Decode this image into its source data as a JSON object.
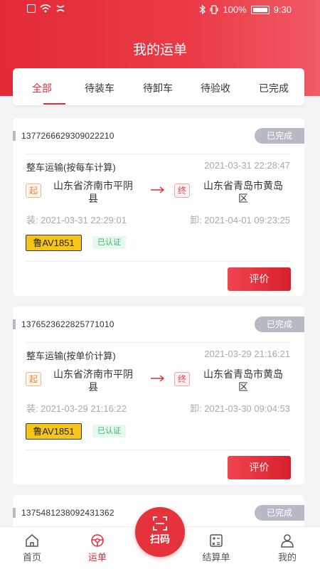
{
  "status_bar": {
    "battery": "100%",
    "time": "9:30"
  },
  "title": "我的运单",
  "tabs": [
    {
      "label": "全部",
      "active": true
    },
    {
      "label": "待装车"
    },
    {
      "label": "待卸车"
    },
    {
      "label": "待验收"
    },
    {
      "label": "已完成"
    }
  ],
  "orders": [
    {
      "id": "1377266629309022210",
      "status": "已完成",
      "type": "整车运输(按每车计算)",
      "time": "2021-03-31 22:28:47",
      "from_tag": "起",
      "from_line1": "山东省济南市平阴",
      "from_line2": "县",
      "to_tag": "终",
      "to_line1": "山东省青岛市黄岛",
      "to_line2": "区",
      "load": "装: 2021-03-31 22:29:01",
      "unload": "卸: 2021-04-01 09:23:25",
      "plate": "鲁AV1851",
      "verified": "已认证",
      "action": "评价"
    },
    {
      "id": "1376523622825771010",
      "status": "已完成",
      "type": "整车运输(按单价计算)",
      "time": "2021-03-29 21:16:21",
      "from_tag": "起",
      "from_line1": "山东省济南市平阴",
      "from_line2": "县",
      "to_tag": "终",
      "to_line1": "山东省青岛市黄岛",
      "to_line2": "区",
      "load": "装: 2021-03-29 21:16:22",
      "unload": "卸: 2021-03-30 09:04:53",
      "plate": "鲁AV1851",
      "verified": "已认证",
      "action": "评价"
    },
    {
      "id": "1375481238092431362",
      "status": "已完成"
    }
  ],
  "nav": {
    "home": "首页",
    "waybill": "运单",
    "scan": "扫码",
    "settlement": "结算单",
    "mine": "我的"
  },
  "colors": {
    "accent": "#e32a38",
    "badge": "#b7b9c5",
    "plate": "#f5c518"
  }
}
